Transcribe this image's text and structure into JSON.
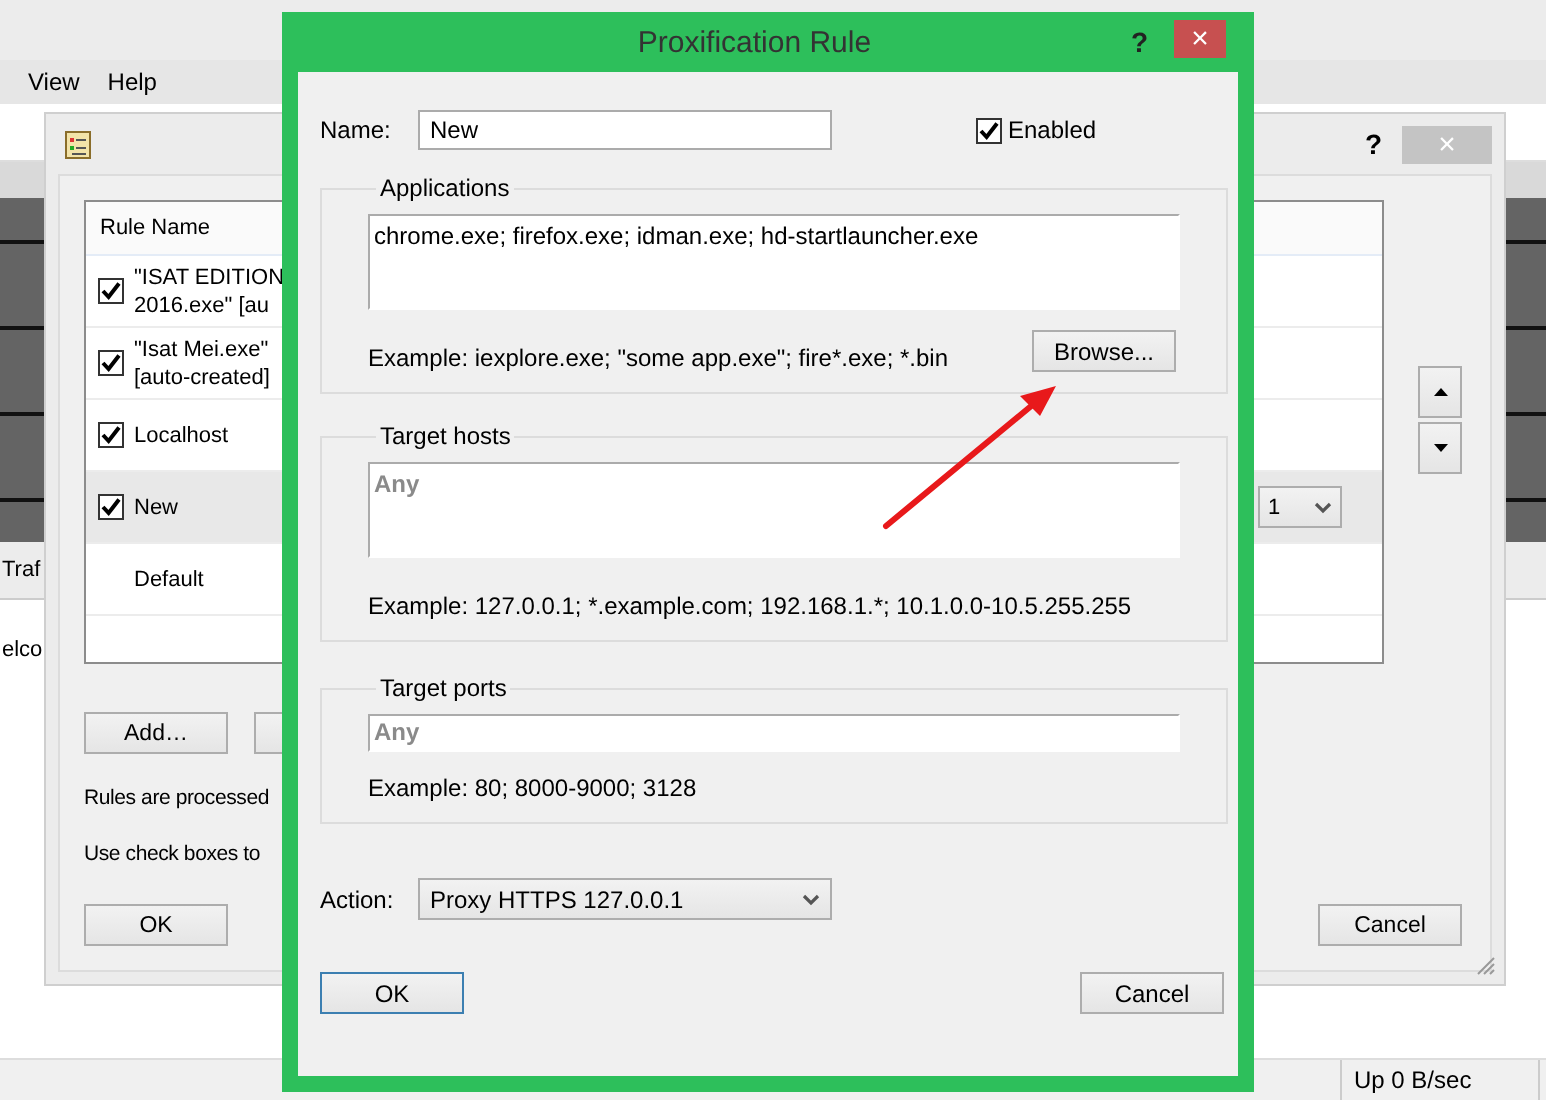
{
  "app": {
    "menu": [
      "View",
      "Help"
    ],
    "tab_fragment": "Traf",
    "log_fragment": "elco",
    "status_bar": [
      "Up 0 B/sec"
    ]
  },
  "rules_window": {
    "help": "?",
    "close": "×",
    "columns": [
      "Rule Name"
    ],
    "rules": [
      {
        "kind": "checkable",
        "name_lines": [
          "\"ISAT EDITION",
          "2016.exe\" [au"
        ],
        "checked": true,
        "selected": false
      },
      {
        "kind": "checkable",
        "name_lines": [
          "\"Isat Mei.exe\"",
          "[auto-created]"
        ],
        "checked": true,
        "selected": false
      },
      {
        "kind": "checkable",
        "name_lines": [
          "Localhost"
        ],
        "checked": true,
        "selected": false
      },
      {
        "kind": "checkable",
        "name_lines": [
          "New"
        ],
        "checked": true,
        "selected": true,
        "column_3": "1"
      },
      {
        "kind": "fixed",
        "name_lines": [
          "Default"
        ],
        "selected": false
      }
    ],
    "buttons": [
      "Add…"
    ],
    "notes": [
      "Rules are processed",
      "Use check boxes to"
    ],
    "ok": "OK",
    "cancel": "Cancel"
  },
  "dialog": {
    "title": "Proxification Rule",
    "help": "?",
    "close": "×",
    "name": {
      "label": "Name:",
      "value": "New"
    },
    "enabled": {
      "label": "Enabled",
      "checked": true
    },
    "applications": {
      "title": "Applications",
      "value": "chrome.exe; firefox.exe; idman.exe; hd-startlauncher.exe",
      "example": "Example: iexplore.exe; \"some app.exe\"; fire*.exe; *.bin",
      "button": "Browse..."
    },
    "target_hosts": {
      "title": "Target hosts",
      "placeholder": "Any",
      "example": "Example: 127.0.0.1; *.example.com; 192.168.1.*; 10.1.0.0-10.5.255.255"
    },
    "target_ports": {
      "title": "Target ports",
      "placeholder": "Any",
      "example": "Example: 80; 8000-9000; 3128"
    },
    "action": {
      "label": "Action:",
      "value": "Proxy HTTPS 127.0.0.1"
    },
    "ok": "OK",
    "cancel": "Cancel"
  }
}
